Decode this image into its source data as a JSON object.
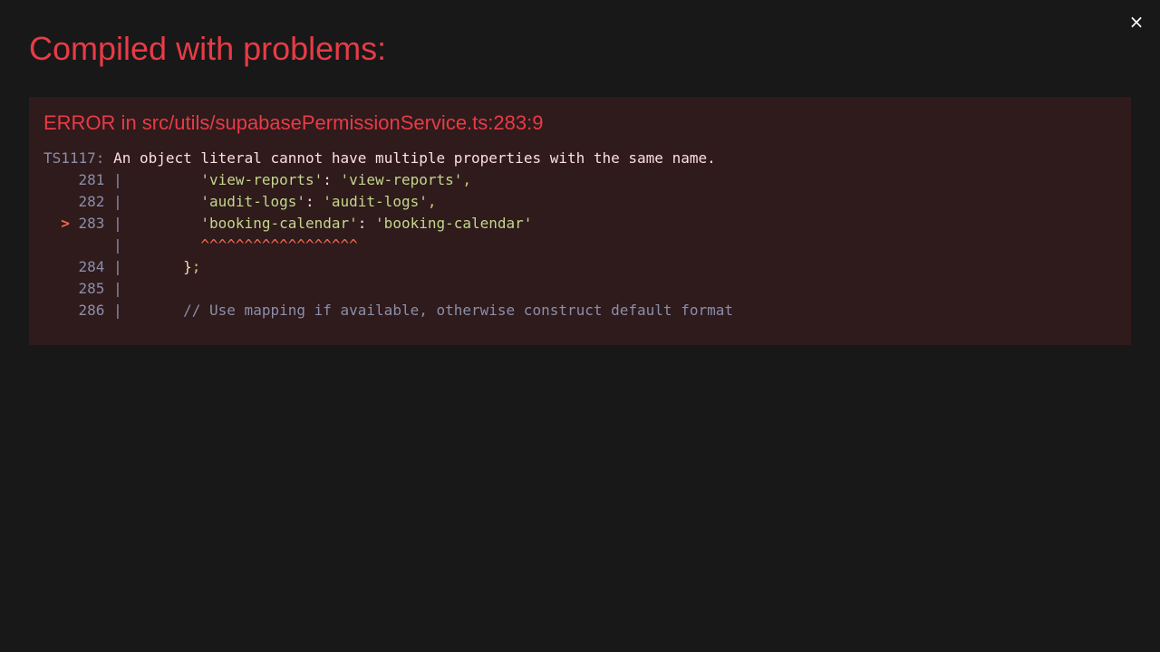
{
  "overlay": {
    "title": "Compiled with problems:",
    "close_icon": "×"
  },
  "error": {
    "header": "ERROR in src/utils/supabasePermissionService.ts:283:9",
    "code_label": "TS1117:",
    "message": " An object literal cannot have multiple properties with the same name.",
    "lines": {
      "l281": {
        "num": "    281 | ",
        "indent": "        ",
        "key": "'view-reports'",
        "colon": ": ",
        "value": "'view-reports'",
        "comma": ","
      },
      "l282": {
        "num": "    282 | ",
        "indent": "        ",
        "key": "'audit-logs'",
        "colon": ": ",
        "value": "'audit-logs'",
        "comma": ","
      },
      "l283": {
        "marker": "  > ",
        "num": "283 | ",
        "indent": "        ",
        "key": "'booking-calendar'",
        "colon": ": ",
        "value": "'booking-calendar'"
      },
      "caret": {
        "num": "        | ",
        "indent": "        ",
        "carets": "^^^^^^^^^^^^^^^^^^"
      },
      "l284": {
        "num": "    284 | ",
        "indent": "      ",
        "brace": "}",
        "semi": ";"
      },
      "l285": {
        "num": "    285 | "
      },
      "l286": {
        "num": "    286 | ",
        "indent": "      ",
        "comment": "// Use mapping if available, otherwise construct default format"
      }
    }
  },
  "colors": {
    "background": "#181818",
    "panel": "#2f1a1c",
    "error_red": "#e83b46",
    "string_green": "#c3d78a",
    "marker_orange": "#f2694f",
    "dim_gray": "#8a8fa8"
  }
}
